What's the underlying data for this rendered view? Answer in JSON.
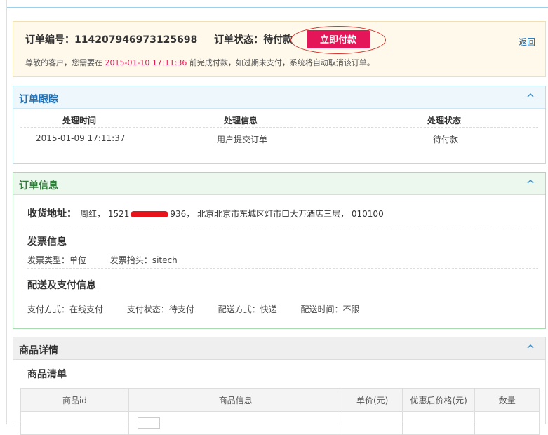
{
  "summary": {
    "order_no_label": "订单编号：",
    "order_no": "114207946973125698",
    "status_label": "订单状态：",
    "status": "待付款",
    "pay_button": "立即付款",
    "back_link": "返回",
    "notice_before": "尊敬的客户，您需要在 ",
    "deadline": "2015-01-10 17:11:36",
    "notice_after": " 前完成付款，如过期未支付，系统将自动取消该订单。"
  },
  "tracking": {
    "title": "订单跟踪",
    "headers": [
      "处理时间",
      "处理信息",
      "处理状态"
    ],
    "rows": [
      {
        "time": "2015-01-09 17:11:37",
        "info": "用户提交订单",
        "status": "待付款"
      }
    ]
  },
  "order_info": {
    "title": "订单信息",
    "address_label": "收货地址：",
    "address_prefix": "周红， 1521",
    "address_suffix": "936， 北京北京市东城区灯市口大万酒店三层， 010100",
    "invoice_title": "发票信息",
    "invoice_type": "发票类型：单位",
    "invoice_header": "发票抬头：sitech",
    "delivery_title": "配送及支付信息",
    "pay_method": "支付方式：在线支付",
    "pay_status": "支付状态：待支付",
    "ship_method": "配送方式：快递",
    "ship_time": "配送时间：不限"
  },
  "goods": {
    "title": "商品详情",
    "sub_title": "商品清单",
    "headers": [
      "商品id",
      "商品信息",
      "单价(元)",
      "优惠后价格(元)",
      "数量"
    ]
  },
  "colors": {
    "accent_pink": "#e5155a",
    "link_blue": "#1a6fb5"
  }
}
